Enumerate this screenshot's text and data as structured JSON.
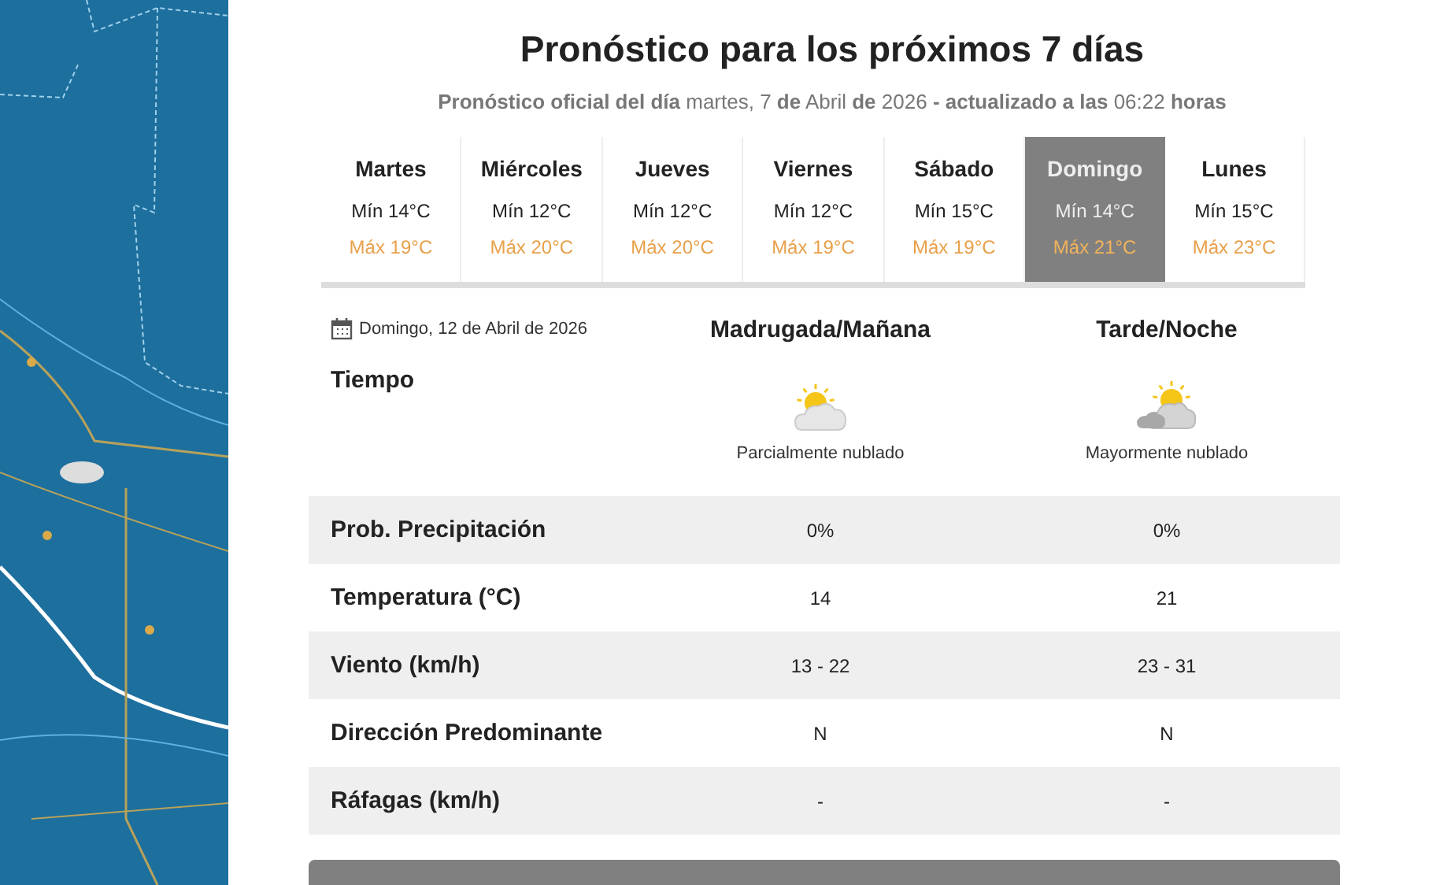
{
  "title": "Pronóstico para los próximos 7 días",
  "subtitle": "**Pronóstico oficial del día** martes, 7 **de** Abril **de** 2026 **- actualizado a las** 06:22 **horas**",
  "days": [
    {
      "day": "Martes",
      "min": "Mín 14°C",
      "max": "Máx 19°C",
      "selected": false
    },
    {
      "day": "Miércoles",
      "min": "Mín 12°C",
      "max": "Máx 20°C",
      "selected": false
    },
    {
      "day": "Jueves",
      "min": "Mín 12°C",
      "max": "Máx 20°C",
      "selected": false
    },
    {
      "day": "Viernes",
      "min": "Mín 12°C",
      "max": "Máx 19°C",
      "selected": false
    },
    {
      "day": "Sábado",
      "min": "Mín 15°C",
      "max": "Máx 19°C",
      "selected": false
    },
    {
      "day": "Domingo",
      "min": "Mín 14°C",
      "max": "Máx 21°C",
      "selected": true
    },
    {
      "day": "Lunes",
      "min": "Mín 15°C",
      "max": "Máx 23°C",
      "selected": false
    }
  ],
  "detail": {
    "date": "Domingo, 12 de Abril de 2026",
    "periods": [
      "Madrugada/Mañana",
      "Tarde/Noche"
    ],
    "sky_label": "Tiempo",
    "sky": [
      {
        "kind": "partly",
        "text": "Parcialmente nublado"
      },
      {
        "kind": "mostly",
        "text": "Mayormente nublado"
      }
    ],
    "rows": [
      {
        "label": "Prob. Precipitación",
        "values": [
          "0%",
          "0%"
        ]
      },
      {
        "label": "Temperatura (°C)",
        "values": [
          "14",
          "21"
        ]
      },
      {
        "label": "Viento (km/h)",
        "values": [
          "13 - 22",
          "23 - 31"
        ]
      },
      {
        "label": "Dirección Predominante",
        "values": [
          "N",
          "N"
        ]
      },
      {
        "label": "Ráfagas (km/h)",
        "values": [
          "-",
          "-"
        ]
      }
    ]
  }
}
